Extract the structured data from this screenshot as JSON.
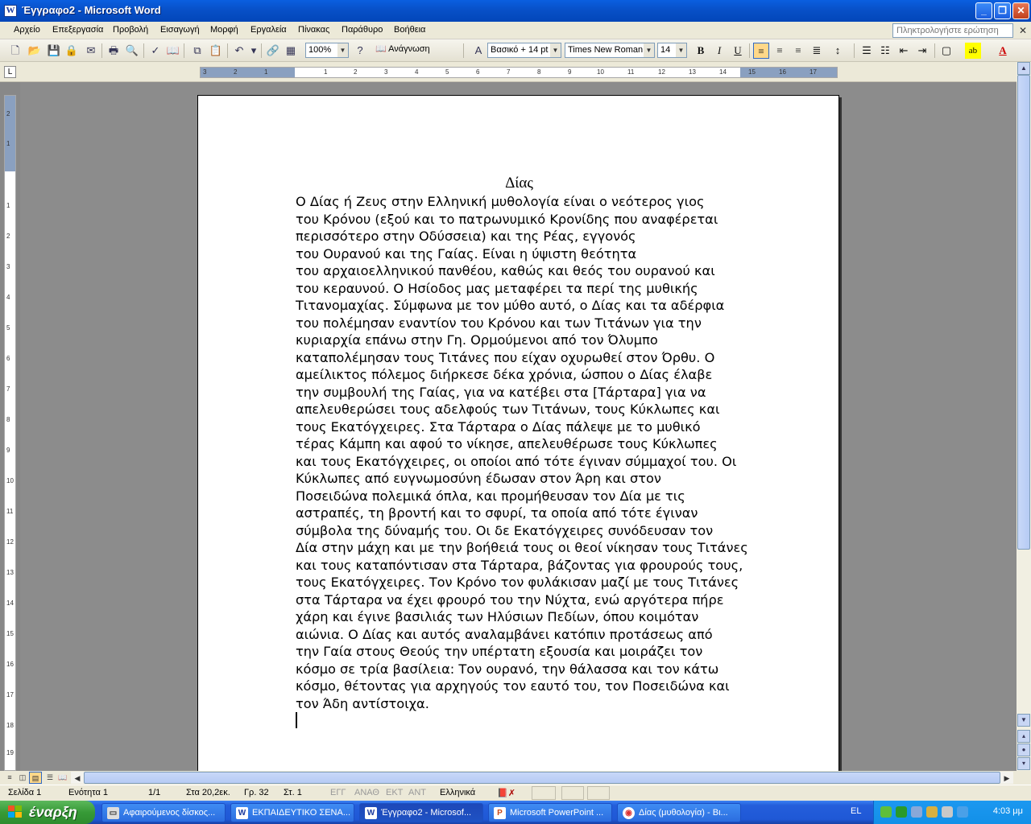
{
  "window": {
    "title": "Έγγραφο2 - Microsoft Word",
    "controls": {
      "minimize": "_",
      "maximize": "❐",
      "close": "✕"
    }
  },
  "menu": {
    "items": [
      "Αρχείο",
      "Επεξεργασία",
      "Προβολή",
      "Εισαγωγή",
      "Μορφή",
      "Εργαλεία",
      "Πίνακας",
      "Παράθυρο",
      "Βοήθεια"
    ],
    "ask_placeholder": "Πληκτρολογήστε ερώτηση"
  },
  "toolbar": {
    "zoom": "100%",
    "reading_label": "Ανάγνωση",
    "style": "Βασικό + 14 pt",
    "font": "Times New Roman",
    "size": "14",
    "bold": "B",
    "italic": "I",
    "underline": "U"
  },
  "ruler": {
    "h_labels": [
      "3",
      "2",
      "1",
      "1",
      "2",
      "3",
      "4",
      "5",
      "6",
      "7",
      "8",
      "9",
      "10",
      "11",
      "12",
      "13",
      "14",
      "15",
      "16",
      "17"
    ],
    "v_labels": [
      "2",
      "1",
      "1",
      "2",
      "3",
      "4",
      "5",
      "6",
      "7",
      "8",
      "9",
      "10",
      "11",
      "12",
      "13",
      "14",
      "15",
      "16",
      "17",
      "18",
      "19"
    ]
  },
  "document": {
    "title": "Δίας",
    "lines": [
      "Ο Δίας ή Ζευς στην Ελληνική μυθολογία είναι ο νεότερος γιος",
      "του Κρόνου (εξού και το πατρωνυμικό Κρονίδης που αναφέρεται",
      "περισσότερο στην Οδύσσεια) και της Ρέας, εγγονός",
      "του Ουρανού και της Γαίας. Είναι η ύψιστη θεότητα",
      "του αρχαιοελληνικού πανθέου, καθώς και θεός του ουρανού και",
      "του κεραυνού. Ο Ησίοδος μας μεταφέρει τα περί της μυθικής",
      "Τιτανομαχίας. Σύμφωνα με τον μύθο αυτό, ο Δίας και τα αδέρφια",
      "του πολέμησαν εναντίον του Κρόνου και των Τιτάνων για την",
      "κυριαρχία επάνω στην Γη. Ορμούμενοι από τον Όλυμπο",
      "καταπολέμησαν τους Τιτάνες που είχαν οχυρωθεί στον Όρθυ. Ο",
      "αμείλικτος πόλεμος διήρκεσε δέκα χρόνια, ώσπου ο Δίας έλαβε",
      "την συμβουλή της Γαίας, για να κατέβει στα [Τάρταρα] για να",
      "απελευθερώσει τους αδελφούς των Τιτάνων, τους Κύκλωπες και",
      "τους Εκατόγχειρες. Στα Τάρταρα ο Δίας πάλεψε με το μυθικό",
      "τέρας Κάμπη και αφού το νίκησε, απελευθέρωσε τους Κύκλωπες",
      "και τους Εκατόγχειρες, οι οποίοι από τότε έγιναν σύμμαχοί του. Οι",
      "Κύκλωπες από ευγνωμοσύνη έδωσαν στον Άρη και στον",
      "Ποσειδώνα πολεμικά όπλα, και προμήθευσαν τον Δία με τις",
      "αστραπές, τη βροντή και το σφυρί, τα οποία από τότε έγιναν",
      "σύμβολα της δύναμής του. Οι δε Εκατόγχειρες συνόδευσαν τον",
      "Δία στην μάχη και με την βοήθειά τους οι θεοί νίκησαν τους Τιτάνες",
      "και τους καταπόντισαν στα Τάρταρα, βάζοντας για φρουρούς τους,",
      "τους Εκατόγχειρες. Τον Κρόνο τον φυλάκισαν μαζί με τους Τιτάνες",
      "στα Τάρταρα να έχει φρουρό του την Νύχτα, ενώ αργότερα πήρε",
      "χάρη και έγινε βασιλιάς των Ηλύσιων Πεδίων, όπου κοιμόταν",
      "αιώνια. Ο Δίας και αυτός αναλαμβάνει κατόπιν προτάσεως από",
      "την Γαία στους Θεούς την υπέρτατη εξουσία και μοιράζει τον",
      "κόσμο σε τρία βασίλεια: Τον ουρανό, την θάλασσα και τον κάτω",
      "κόσμο, θέτοντας για αρχηγούς τον εαυτό του, τον Ποσειδώνα και",
      "τον Άδη αντίστοιχα."
    ]
  },
  "statusbar": {
    "page": "Σελίδα 1",
    "section": "Ενότητα 1",
    "pages": "1/1",
    "at": "Στα 20,2εκ.",
    "line": "Γρ. 32",
    "col": "Στ. 1",
    "rec": "ΕΓΓ",
    "trk": "ΑΝΑΘ",
    "ext": "ΕΚΤ",
    "ovr": "ΑΝΤ",
    "language": "Ελληνικά"
  },
  "taskbar": {
    "start": "έναρξη",
    "tasks": [
      "Αφαιρούμενος δίσκος...",
      "ΕΚΠΑΙΔΕΥΤΙΚΟ ΣΕΝΑ...",
      "Έγγραφο2 - Microsof...",
      "Microsoft PowerPoint ...",
      "Δίας (μυθολογία) - Βι..."
    ],
    "language": "EL",
    "clock": "4:03 μμ"
  }
}
